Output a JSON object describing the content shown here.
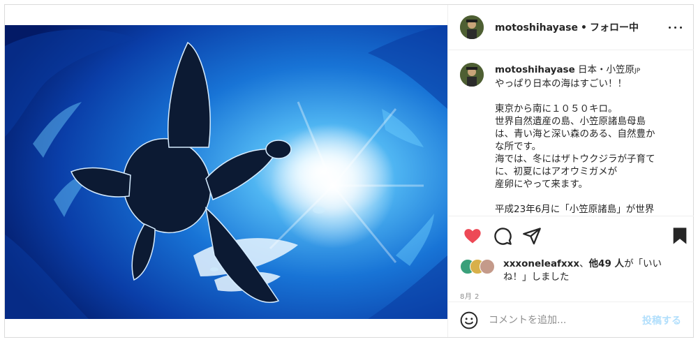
{
  "post": {
    "username": "motoshihayase",
    "follow_status": "フォロー中",
    "header_separator": "•",
    "image_alt": "sea turtle silhouette against sun, underwater"
  },
  "caption": {
    "username": "motoshihayase",
    "location": "日本・小笠原",
    "location_suffix": "JP",
    "lines": [
      "やっぱり日本の海はすごい！！",
      "",
      "東京から南に１０５０キロ。",
      "世界自然遺産の島、小笠原諸島母島",
      "は、青い海と深い森のある、自然豊か",
      "な所です。",
      "海では、冬にはザトウクジラが子育て",
      "に、初夏にはアオウミガメが",
      "産卵にやって来ます。",
      "",
      "平成23年6月に「小笠原諸島」が世界"
    ]
  },
  "likes": {
    "user": "xxxoneleafxxx",
    "others": "他49 人",
    "suffix_1": "が「いい",
    "suffix_2": "ね！」しました"
  },
  "date": "8月 2",
  "comment": {
    "placeholder": "コメントを追加...",
    "post_label": "投稿する"
  },
  "icons": {
    "like": "heart-icon",
    "comment": "comment-icon",
    "share": "share-icon",
    "save": "bookmark-icon",
    "more": "more-icon",
    "emoji": "emoji-icon"
  },
  "colors": {
    "like_red": "#ed4956",
    "post_button_disabled": "#b2dffc",
    "secondary_text": "#8e8e8e",
    "border": "#dbdbdb"
  }
}
